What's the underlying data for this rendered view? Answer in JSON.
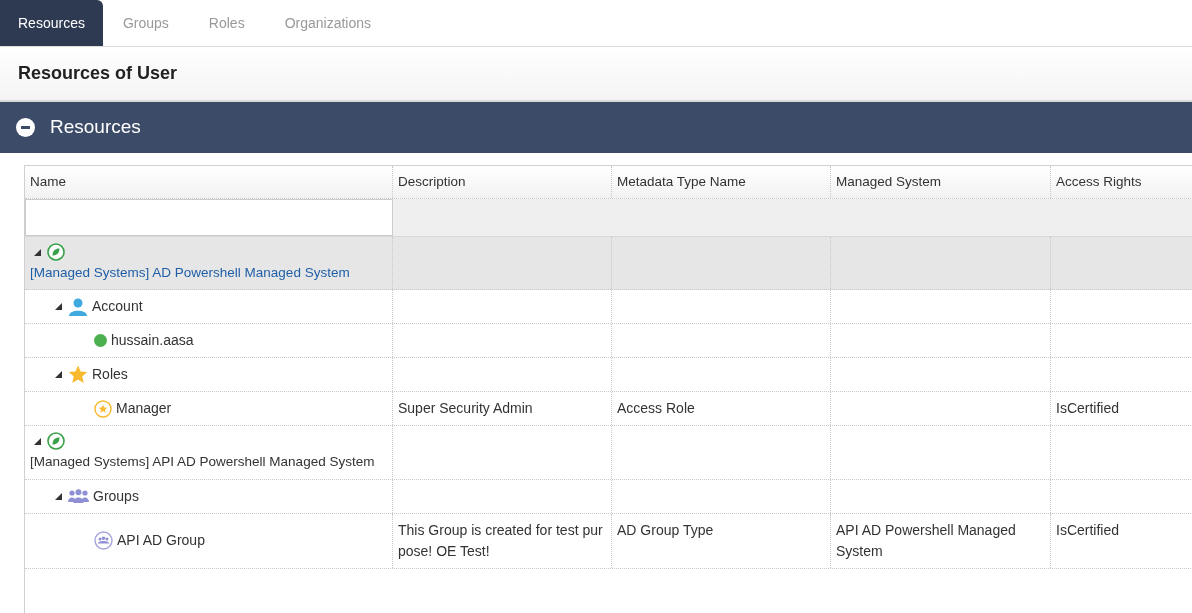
{
  "tabs": [
    {
      "label": "Resources",
      "selected": true
    },
    {
      "label": "Groups",
      "selected": false
    },
    {
      "label": "Roles",
      "selected": false
    },
    {
      "label": "Organizations",
      "selected": false
    }
  ],
  "page_title": "Resources of User",
  "panel": {
    "title": "Resources",
    "expanded": true
  },
  "table": {
    "columns": [
      "Name",
      "Description",
      "Metadata Type Name",
      "Managed System",
      "Access Rights"
    ],
    "rows": [
      {
        "kind": "system",
        "name": "[Managed Systems] AD Powershell Managed System",
        "expanded": true,
        "selected": true,
        "children": [
          {
            "kind": "account",
            "name": "Account",
            "expanded": true,
            "selected": false,
            "children": [
              {
                "kind": "user",
                "name": "hussain.aasa",
                "selected": false
              }
            ]
          },
          {
            "kind": "roles",
            "name": "Roles",
            "expanded": true,
            "selected": false,
            "children": [
              {
                "kind": "role",
                "name": "Manager",
                "selected": false,
                "description": "Super Security Admin",
                "metadata_type": "Access Role",
                "access_rights": "IsCertified"
              }
            ]
          }
        ]
      },
      {
        "kind": "system",
        "name": "[Managed Systems] API AD Powershell Managed System",
        "expanded": true,
        "selected": false,
        "children": [
          {
            "kind": "groups",
            "name": "Groups",
            "expanded": true,
            "selected": false,
            "children": [
              {
                "kind": "group",
                "name": "API AD Group",
                "selected": false,
                "description": "This Group is created for test purpose! OE Test!",
                "metadata_type": "AD Group Type",
                "managed_system": "API AD Powershell Managed System",
                "access_rights": "IsCertified"
              }
            ]
          }
        ]
      }
    ]
  }
}
